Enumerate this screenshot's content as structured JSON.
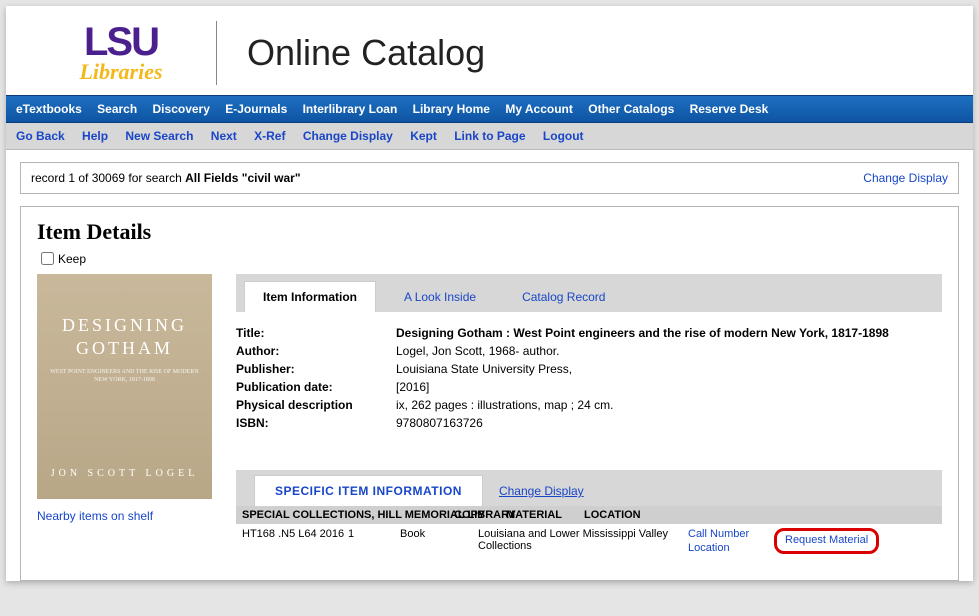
{
  "header": {
    "logo_top": "LSU",
    "logo_bottom": "Libraries",
    "catalog_title": "Online Catalog"
  },
  "nav_primary": [
    "eTextbooks",
    "Search",
    "Discovery",
    "E-Journals",
    "Interlibrary Loan",
    "Library Home",
    "My Account",
    "Other Catalogs",
    "Reserve Desk"
  ],
  "nav_secondary": [
    "Go Back",
    "Help",
    "New Search",
    "Next",
    "X-Ref",
    "Change Display",
    "Kept",
    "Link to Page",
    "Logout"
  ],
  "search": {
    "prefix": "record 1 of 30069 for search ",
    "bold": "All Fields \"civil war\"",
    "change_display": "Change Display"
  },
  "details": {
    "heading": "Item Details",
    "keep_label": "Keep",
    "nearby": "Nearby items on shelf",
    "cover": {
      "line1": "DESIGNING",
      "line2": "GOTHAM",
      "sub": "WEST POINT ENGINEERS AND THE RISE OF MODERN NEW YORK, 1817-1898",
      "author": "JON SCOTT LOGEL"
    }
  },
  "tabs": {
    "active": "Item Information",
    "t2": "A Look Inside",
    "t3": "Catalog Record"
  },
  "meta": {
    "title_label": "Title:",
    "title_value": "Designing Gotham : West Point engineers and the rise of modern New York, 1817-1898",
    "author_label": "Author:",
    "author_value": "Logel, Jon Scott, 1968- author.",
    "publisher_label": "Publisher:",
    "publisher_value": "Louisiana State University Press,",
    "pubdate_label": "Publication date:",
    "pubdate_value": "[2016]",
    "phys_label": "Physical description",
    "phys_value": "ix, 262 pages : illustrations, map ; 24 cm.",
    "isbn_label": "ISBN:",
    "isbn_value": "9780807163726"
  },
  "specific": {
    "tab_active": "SPECIFIC ITEM INFORMATION",
    "change_display": "Change Display",
    "library_name": "SPECIAL COLLECTIONS, HILL MEMORIAL LIBRARY",
    "th_copy": "COPY",
    "th_material": "MATERIAL",
    "th_location": "LOCATION",
    "row": {
      "call_number": "HT168 .N5 L64 2016",
      "copy": "1",
      "material": "Book",
      "location": "Louisiana and Lower Mississippi Valley Collections",
      "link1": "Call Number Location",
      "link2": "Request Material"
    }
  }
}
